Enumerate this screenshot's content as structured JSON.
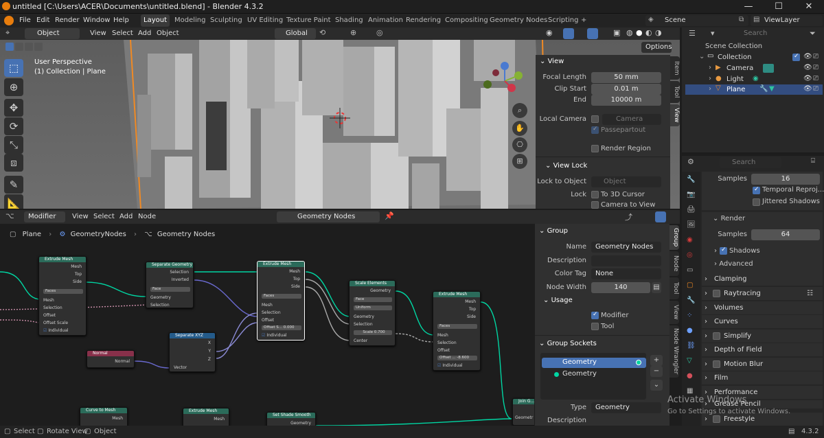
{
  "window": {
    "title": "untitled [C:\\Users\\ACER\\Documents\\untitled.blend] - Blender 4.3.2"
  },
  "menu": {
    "file": "File",
    "edit": "Edit",
    "render": "Render",
    "window": "Window",
    "help": "Help"
  },
  "workspaces": [
    "Layout",
    "Modeling",
    "Sculpting",
    "UV Editing",
    "Texture Paint",
    "Shading",
    "Animation",
    "Rendering",
    "Compositing",
    "Geometry Nodes",
    "Scripting"
  ],
  "add_workspace": "+",
  "scene": {
    "label": "Scene",
    "view_layer": "ViewLayer"
  },
  "viewport_header": {
    "mode": "Object Mode",
    "view": "View",
    "select": "Select",
    "add": "Add",
    "object": "Object",
    "orientation": "Global",
    "options": "Options"
  },
  "viewport": {
    "perspective": "User Perspective",
    "collection": "(1) Collection | Plane"
  },
  "view_panel": {
    "title": "View",
    "focal_length_label": "Focal Length",
    "focal_length": "50 mm",
    "clip_start_label": "Clip Start",
    "clip_start": "0.01 m",
    "end_label": "End",
    "end": "10000 m",
    "local_camera_label": "Local Camera",
    "local_camera": "Camera",
    "passepartout": "Passepartout",
    "render_region": "Render Region",
    "view_lock_title": "View Lock",
    "lock_to_object_label": "Lock to Object",
    "lock_object_placeholder": "Object",
    "lock_label": "Lock",
    "to_3d_cursor": "To 3D Cursor",
    "camera_to_view": "Camera to View"
  },
  "viewport_tabs": [
    "Item",
    "Tool",
    "View"
  ],
  "outliner": {
    "search_placeholder": "Search",
    "scene_collection": "Scene Collection",
    "items": [
      {
        "label": "Collection"
      },
      {
        "label": "Camera"
      },
      {
        "label": "Light"
      },
      {
        "label": "Plane"
      }
    ]
  },
  "node_editor_header": {
    "editor": "Modifier",
    "view": "View",
    "select": "Select",
    "add": "Add",
    "node": "Node",
    "tree_name": "Geometry Nodes"
  },
  "breadcrumb": [
    "Plane",
    "GeometryNodes",
    "Geometry Nodes"
  ],
  "nodes": {
    "extrude1": {
      "title": "Extrude Mesh",
      "mesh": "Mesh",
      "top": "Top",
      "side": "Side",
      "mode": "Faces",
      "in_mesh": "Mesh",
      "selection": "Selection",
      "offset": "Offset",
      "offset_scale": "Offset Scale",
      "individual": "Individual"
    },
    "separate_geo": {
      "title": "Separate Geometry",
      "selection": "Selection",
      "inverted": "Inverted",
      "domain": "Face",
      "geometry": "Geometry",
      "in_selection": "Selection"
    },
    "extrude2": {
      "title": "Extrude Mesh",
      "mesh": "Mesh",
      "top": "Top",
      "side": "Side",
      "mode": "Faces",
      "in_mesh": "Mesh",
      "selection": "Selection",
      "offset": "Offset",
      "offset_scale": "Offset S...",
      "offset_value": "0.000",
      "individual": "Individual"
    },
    "scale_elements": {
      "title": "Scale Elements",
      "geometry": "Geometry",
      "domain": "Face",
      "mode": "Uniform",
      "in_geometry": "Geometry",
      "selection": "Selection",
      "scale": "Scale",
      "scale_value": "0.700",
      "center": "Center"
    },
    "extrude3": {
      "title": "Extrude Mesh",
      "mesh": "Mesh",
      "top": "Top",
      "side": "Side",
      "mode": "Faces",
      "in_mesh": "Mesh",
      "selection": "Selection",
      "offset": "Offset",
      "offset_scale": "Offset ...",
      "offset_value": "-8.600",
      "individual": "Individual"
    },
    "normal": {
      "title": "Normal",
      "out": "Normal"
    },
    "separate_xyz": {
      "title": "Separate XYZ",
      "x": "X",
      "y": "Y",
      "z": "Z",
      "vector": "Vector"
    },
    "curve_to_mesh": {
      "title": "Curve to Mesh",
      "mesh": "Mesh"
    },
    "extrude4": {
      "title": "Extrude Mesh",
      "mesh": "Mesh"
    },
    "set_shade_smooth": {
      "title": "Set Shade Smooth",
      "geometry": "Geometry"
    },
    "join": {
      "title": "Join G...",
      "geometry": "Geometr"
    }
  },
  "group_panel": {
    "title": "Group",
    "name_label": "Name",
    "name": "Geometry Nodes",
    "description_label": "Description",
    "color_tag_label": "Color Tag",
    "color_tag": "None",
    "node_width_label": "Node Width",
    "node_width": "140",
    "usage_title": "Usage",
    "modifier": "Modifier",
    "tool": "Tool",
    "sockets_title": "Group Sockets",
    "sockets": [
      "Geometry",
      "Geometry"
    ],
    "type_label": "Type",
    "type": "Geometry",
    "description2_label": "Description"
  },
  "node_tabs": [
    "Group",
    "Node",
    "Tool",
    "View",
    "Node Wrangler"
  ],
  "properties": {
    "search_placeholder": "Search",
    "samples_label": "Samples",
    "samples": "16",
    "temporal_reprojection": "Temporal Reproj...",
    "jittered_shadows": "Jittered Shadows",
    "render_title": "Render",
    "render_samples_label": "Samples",
    "render_samples": "64",
    "shadows": "Shadows",
    "advanced": "Advanced",
    "sections": [
      "Clamping",
      "Raytracing",
      "Volumes",
      "Curves",
      "Simplify",
      "Depth of Field",
      "Motion Blur",
      "Film",
      "Performance",
      "Grease Pencil",
      "Freestyle"
    ]
  },
  "watermark": {
    "line1": "Activate Windows",
    "line2": "Go to Settings to activate Windows."
  },
  "status": {
    "select": "Select",
    "rotate": "Rotate View",
    "object": "Object",
    "version": "4.3.2"
  },
  "colors": {
    "accent": "#4772b3",
    "geometry_socket": "#00d6a3",
    "node_header": "#2b6b5a",
    "selection_orange": "#f08a24"
  }
}
